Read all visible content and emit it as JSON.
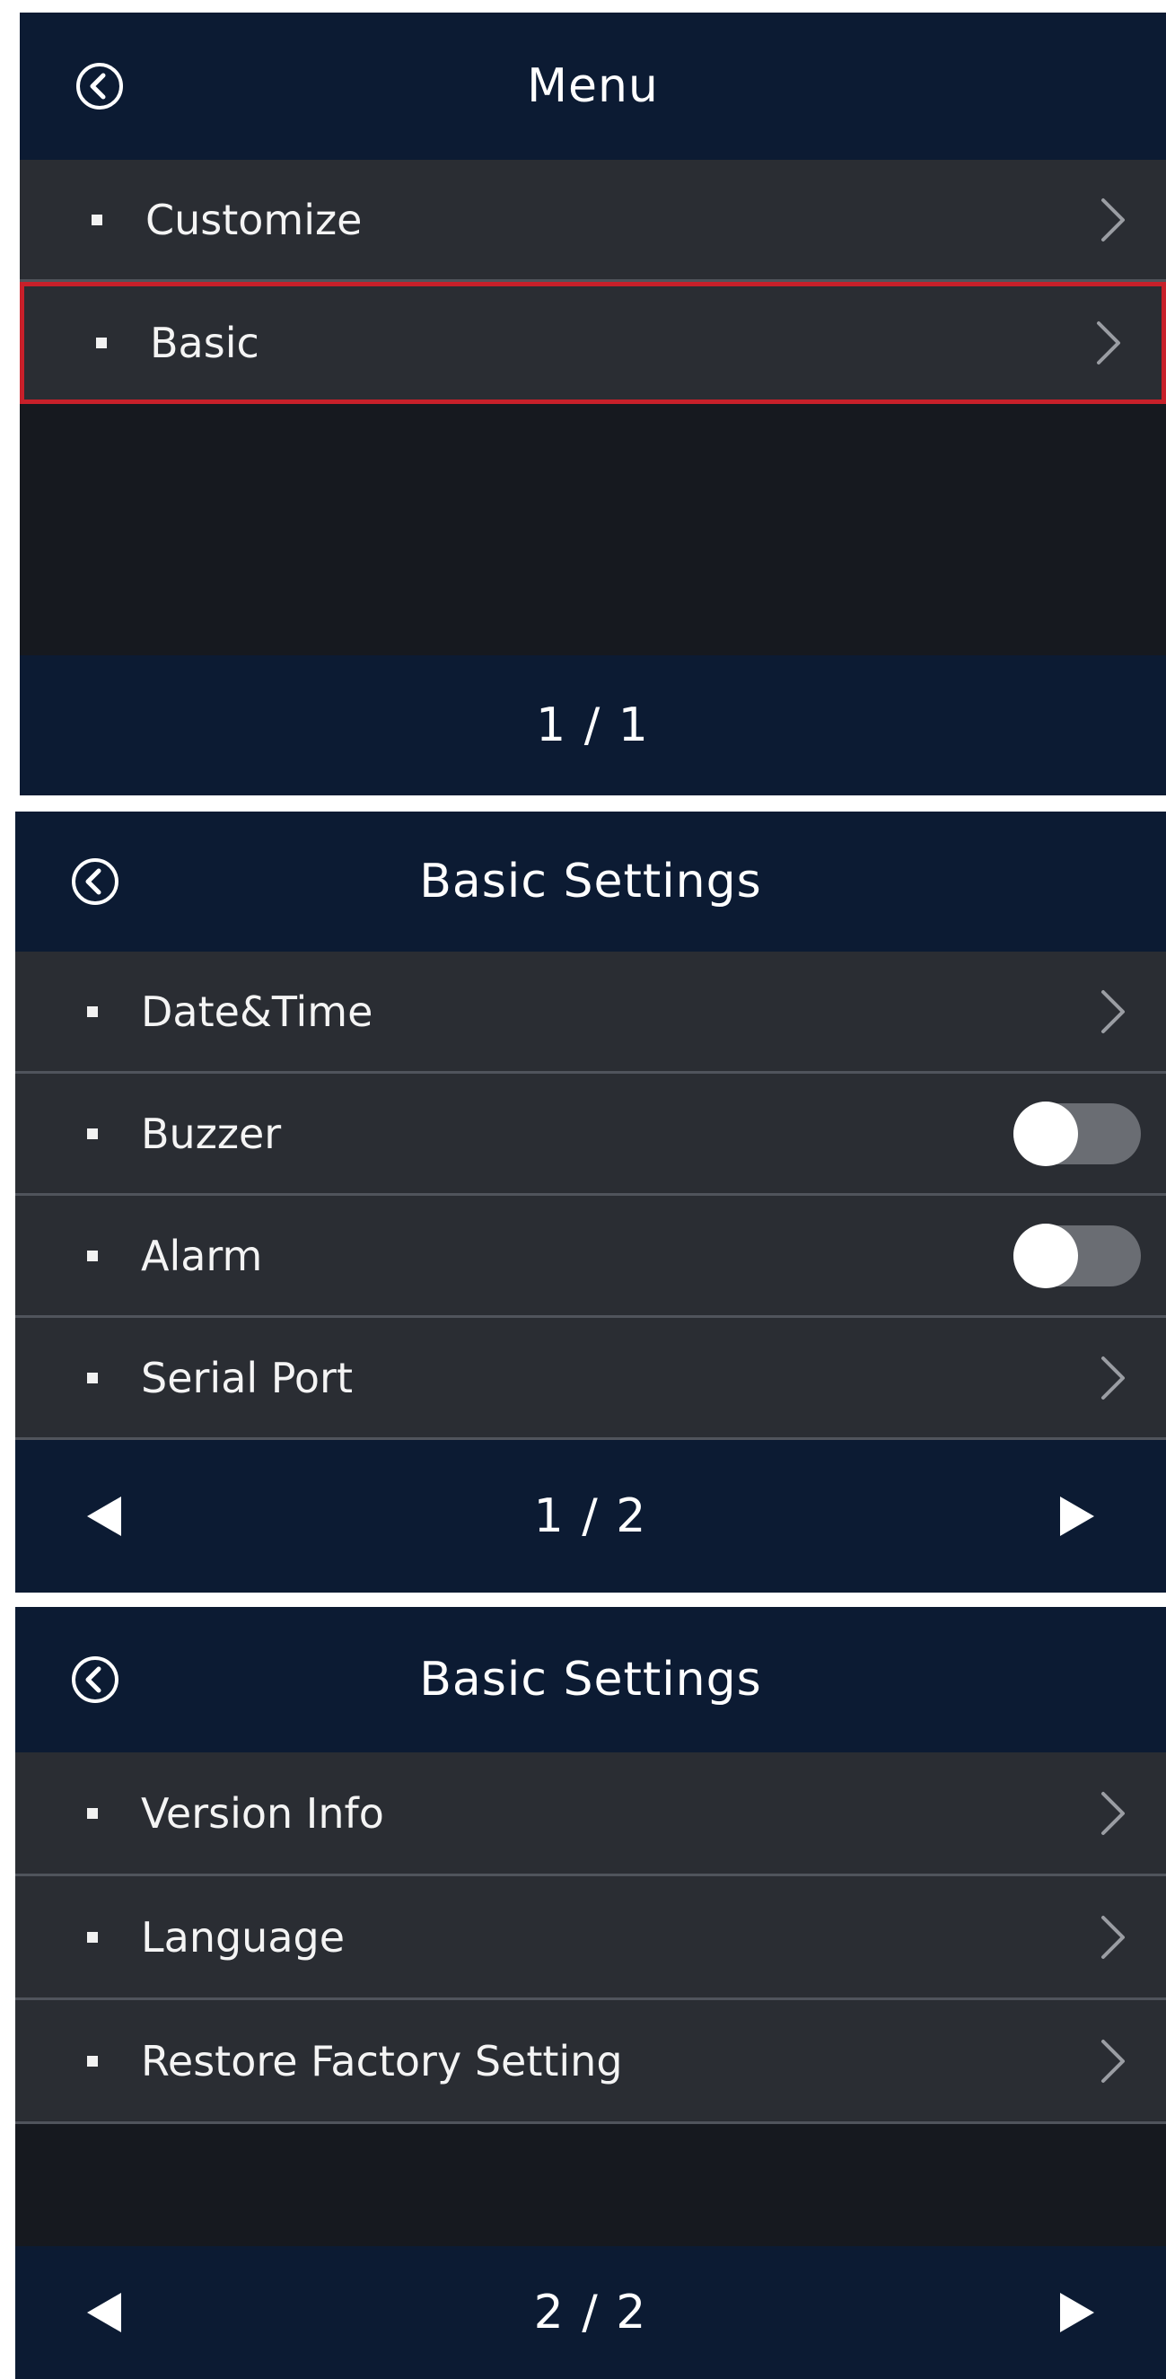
{
  "colors": {
    "header_bg": "#0c1b33",
    "row_bg": "#2a2d33",
    "screen_bg": "#16191f",
    "selection_border": "#c8202a",
    "text": "#ffffff"
  },
  "icons": {
    "back": "circle-chevron-left-icon",
    "chevron": "chevron-right-icon",
    "prev_page": "triangle-left-icon",
    "next_page": "triangle-right-icon"
  },
  "screen1": {
    "title": "Menu",
    "items": [
      {
        "label": "Customize",
        "control": "chevron",
        "selected": false
      },
      {
        "label": "Basic",
        "control": "chevron",
        "selected": true
      }
    ],
    "page": "1 / 1"
  },
  "screen2": {
    "title": "Basic Settings",
    "items": [
      {
        "label": "Date&Time",
        "control": "chevron"
      },
      {
        "label": "Buzzer",
        "control": "toggle",
        "on": false
      },
      {
        "label": "Alarm",
        "control": "toggle",
        "on": false
      },
      {
        "label": "Serial Port",
        "control": "chevron"
      }
    ],
    "page": "1 / 2"
  },
  "screen3": {
    "title": "Basic Settings",
    "items": [
      {
        "label": "Version Info",
        "control": "chevron"
      },
      {
        "label": "Language",
        "control": "chevron"
      },
      {
        "label": "Restore Factory Setting",
        "control": "chevron"
      }
    ],
    "page": "2 / 2"
  }
}
